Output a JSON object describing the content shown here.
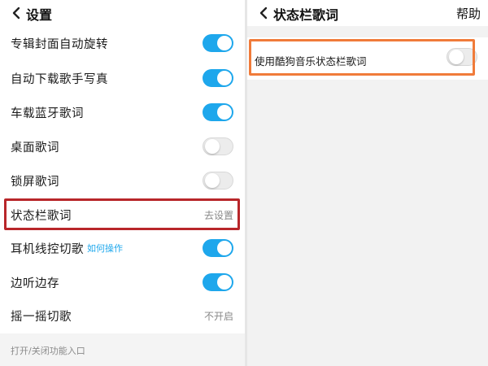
{
  "left_panel": {
    "title": "设置",
    "rows": [
      {
        "label": "专辑封面自动旋转",
        "control": "toggle",
        "state": "on"
      },
      {
        "label": "自动下载歌手写真",
        "control": "toggle",
        "state": "on"
      },
      {
        "label": "车载蓝牙歌词",
        "control": "toggle",
        "state": "on"
      },
      {
        "label": "桌面歌词",
        "control": "toggle",
        "state": "off"
      },
      {
        "label": "锁屏歌词",
        "control": "toggle",
        "state": "off"
      },
      {
        "label": "状态栏歌词",
        "control": "value",
        "value": "去设置",
        "highlighted": true
      },
      {
        "label": "耳机线控切歌",
        "link": "如何操作",
        "control": "toggle",
        "state": "on"
      },
      {
        "label": "边听边存",
        "control": "toggle",
        "state": "on"
      },
      {
        "label": "摇一摇切歌",
        "control": "value",
        "value": "不开启"
      }
    ],
    "footer": "打开/关闭功能入口"
  },
  "right_panel": {
    "title": "状态栏歌词",
    "help_label": "帮助",
    "option": {
      "label": "使用酷狗音乐状态栏歌词",
      "state": "off",
      "highlighted": true
    }
  },
  "colors": {
    "accent": "#1ea7ec",
    "left_highlight": "#b8262a",
    "right_highlight": "#f07b3a"
  },
  "icons": {
    "back": "chevron-left-icon"
  }
}
